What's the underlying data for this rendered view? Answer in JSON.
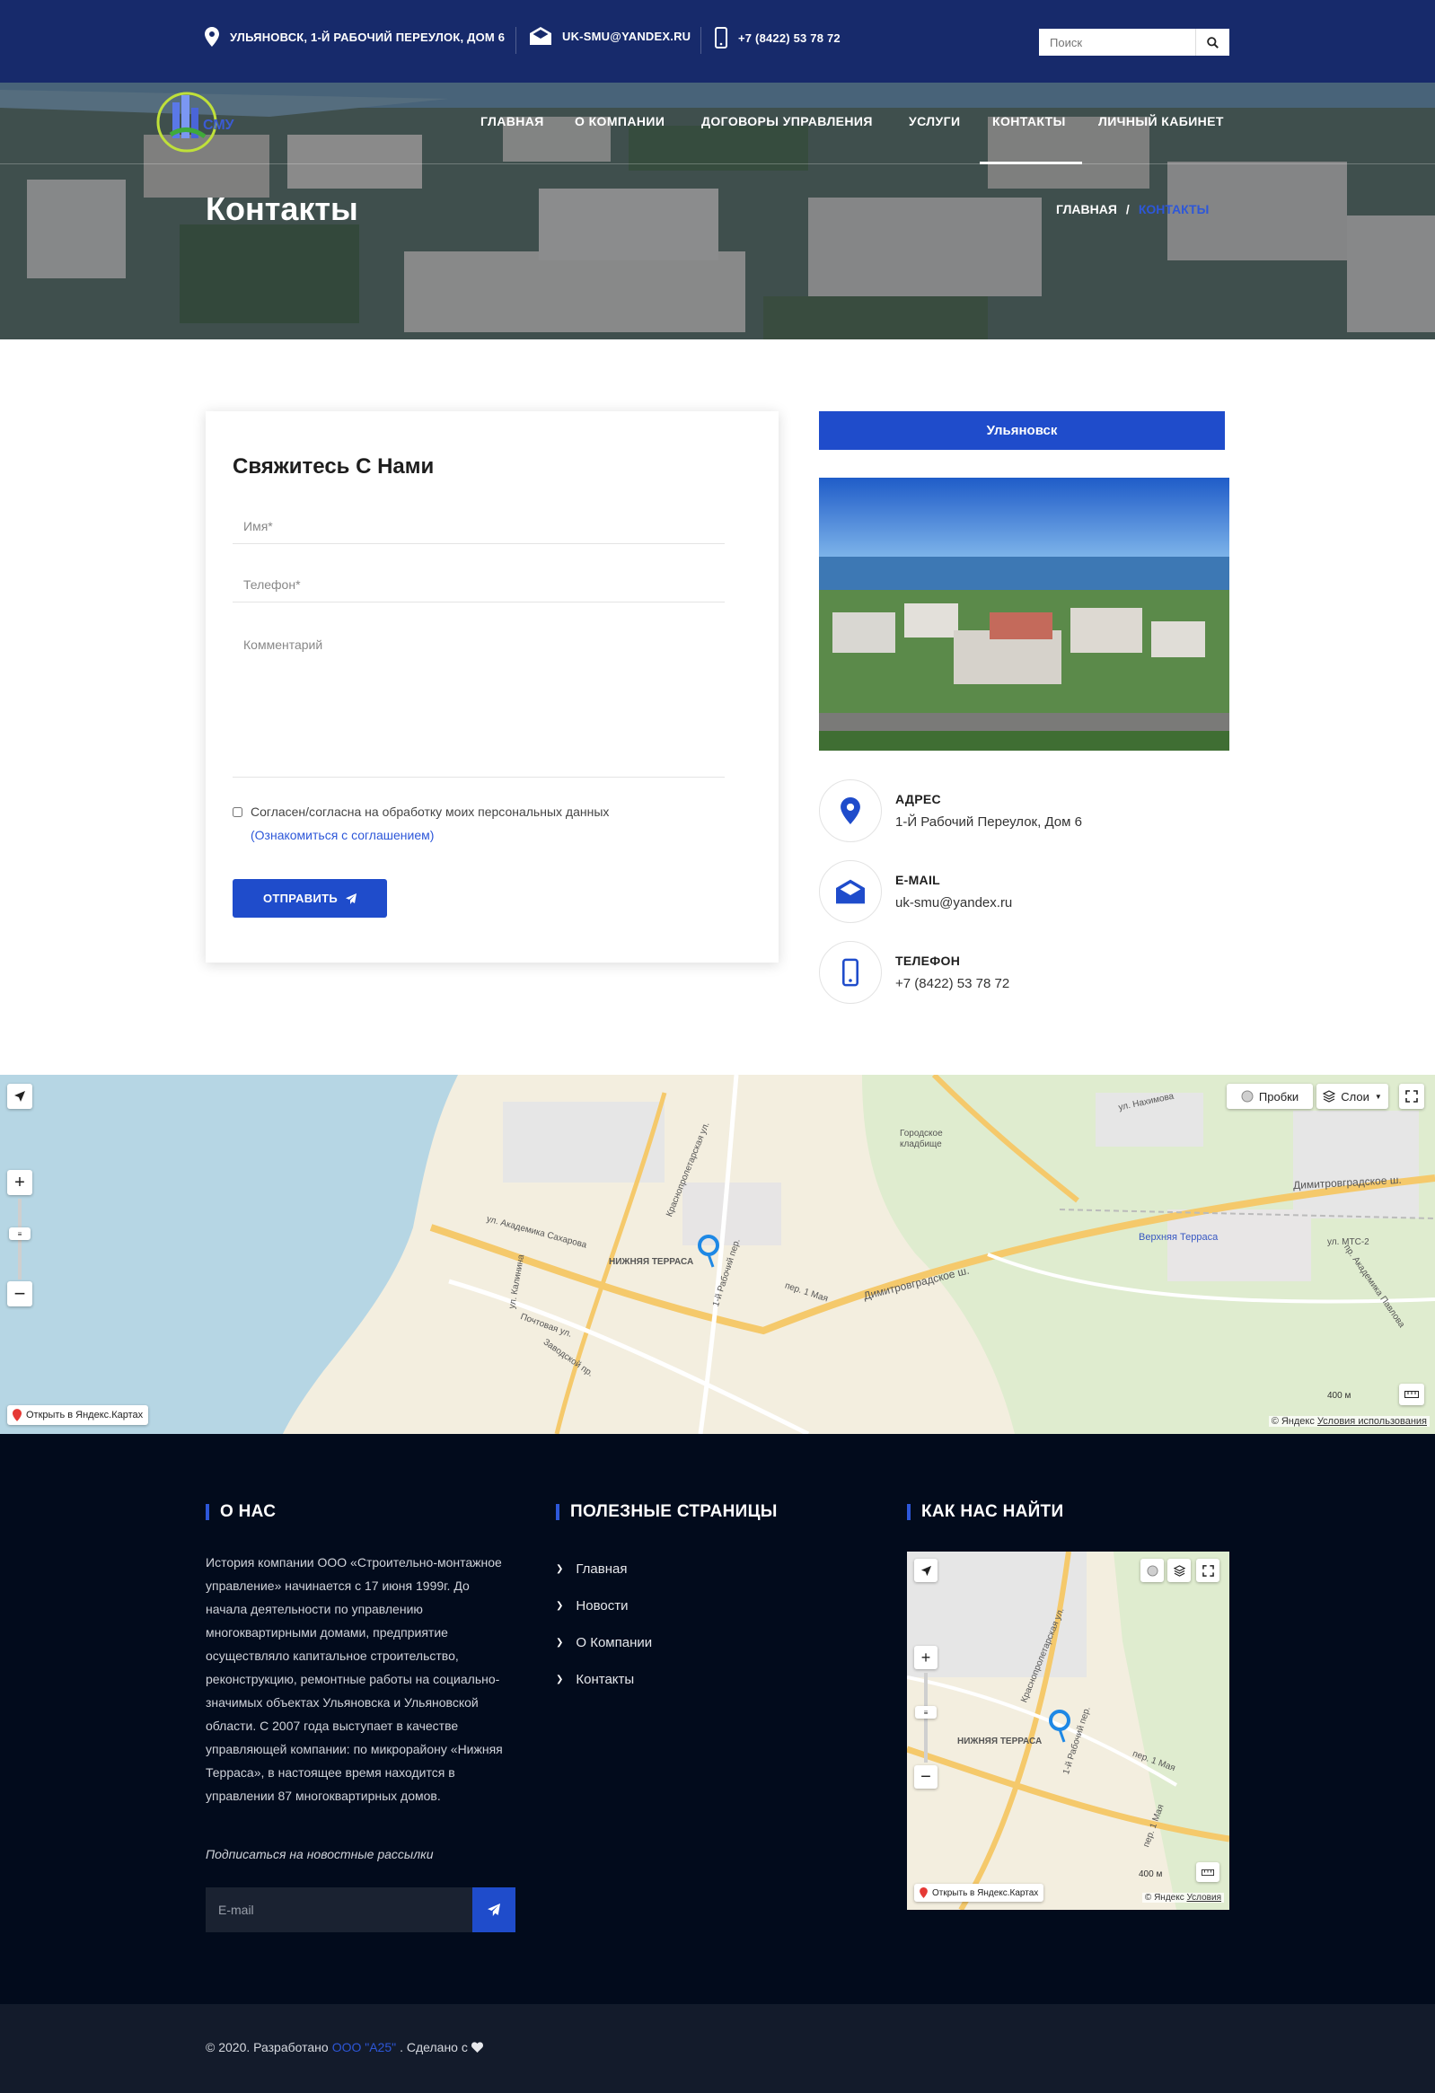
{
  "topbar": {
    "address": "УЛЬЯНОВСК, 1-Й РАБОЧИЙ ПЕРЕУЛОК, ДОМ 6",
    "email": "UK-SMU@YANDEX.RU",
    "phone": "+7 (8422) 53 78 72",
    "search_placeholder": "Поиск"
  },
  "logo": {
    "text": "СМУ"
  },
  "nav": [
    {
      "label": "ГЛАВНАЯ"
    },
    {
      "label": "О КОМПАНИИ"
    },
    {
      "label": "ДОГОВОРЫ УПРАВЛЕНИЯ"
    },
    {
      "label": "УСЛУГИ"
    },
    {
      "label": "КОНТАКТЫ",
      "active": true
    },
    {
      "label": "ЛИЧНЫЙ КАБИНЕТ"
    }
  ],
  "hero": {
    "title": "Контакты",
    "breadcrumb_home": "ГЛАВНАЯ",
    "breadcrumb_sep": "/",
    "breadcrumb_current": "КОНТАКТЫ"
  },
  "form": {
    "title": "Свяжитесь С Нами",
    "name_placeholder": "Имя*",
    "phone_placeholder": "Телефон*",
    "comment_placeholder": "Комментарий",
    "consent_label": "Согласен/согласна на обработку моих персональных данных",
    "agreement_link": "(Ознакомиться с соглашением)",
    "submit_label": "ОТПРАВИТЬ"
  },
  "contacts": {
    "city_button": "Ульяновск",
    "address_label": "АДРЕС",
    "address_value": "1-Й Рабочий Переулок, Дом 6",
    "email_label": "E-MAIL",
    "email_value": "uk-smu@yandex.ru",
    "phone_label": "ТЕЛЕФОН",
    "phone_value": "+7 (8422) 53 78 72"
  },
  "map": {
    "traffic_label": "Пробки",
    "layers_label": "Слои",
    "open_label": "Открыть в Яндекс.Картах",
    "scale_label": "400 м",
    "copyright": "© Яндекс",
    "terms_label": "Условия использования",
    "labels": {
      "terrace_low": "НИЖНЯЯ ТЕРРАСА",
      "terrace_high": "Верхняя Терраса",
      "cemetery": "Городское кладбище",
      "dimitrovgrad_hwy": "Димитровградское ш.",
      "dimitrovgrad_hwy2": "Димитровградское ш.",
      "krasnoproletarskaya": "Краснопролетарская ул.",
      "sakharova": "ул. Академика Сахарова",
      "rabochiy": "1-й Рабочий пер.",
      "pervomaya": "пер. 1 Мая",
      "pochtovaya": "Почтовая ул.",
      "zavodskoy": "Заводской пр.",
      "kalinina": "ул. Калинина",
      "mts": "ул. МТС-2",
      "pavlova": "пр. Академика Павлова",
      "nakhimova": "ул. Нахимова"
    }
  },
  "footer": {
    "about_title": "О НАС",
    "about_text": "История компании ООО «Строительно-монтажное управление» начинается с 17 июня 1999г. До начала деятельности по управлению многоквартирными домами, предприятие осуществляло капитальное строительство, реконструкцию, ремонтные работы на социально-значимых объектах Ульяновска и Ульяновской области. С 2007 года выступает в качестве управляющей компании: по микрорайону «Нижняя Терраса», в настоящее время находится в управлении 87 многоквартирных домов.",
    "subscribe_label": "Подписаться на новостные рассылки",
    "email_placeholder": "E-mail",
    "links_title": "ПОЛЕЗНЫЕ СТРАНИЦЫ",
    "links": [
      {
        "label": "Главная"
      },
      {
        "label": "Новости"
      },
      {
        "label": "О Компании"
      },
      {
        "label": "Контакты"
      }
    ],
    "find_title": "КАК НАС НАЙТИ",
    "mini_map": {
      "open_label": "Открыть в Яндекс.Картах",
      "scale_label": "400 м",
      "copyright": "© Яндекс",
      "terms_label": "Условия",
      "terrace_low": "НИЖНЯЯ ТЕРРАСА",
      "krasnoproletarskaya": "Краснопролетарская ул.",
      "rabochiy": "1-й Рабочий пер.",
      "pervomaya": "пер. 1 Мая",
      "pervomaya2": "пер. 1 Мая"
    },
    "copyright_prefix": "© 2020. Разработано",
    "developer": "ООО \"А25\"",
    "copyright_suffix": ". Сделано с"
  },
  "colors": {
    "topbar": "#172a6b",
    "accent": "#1f4ccb",
    "footer": "#020b1c",
    "bottombar": "#131b2b"
  }
}
